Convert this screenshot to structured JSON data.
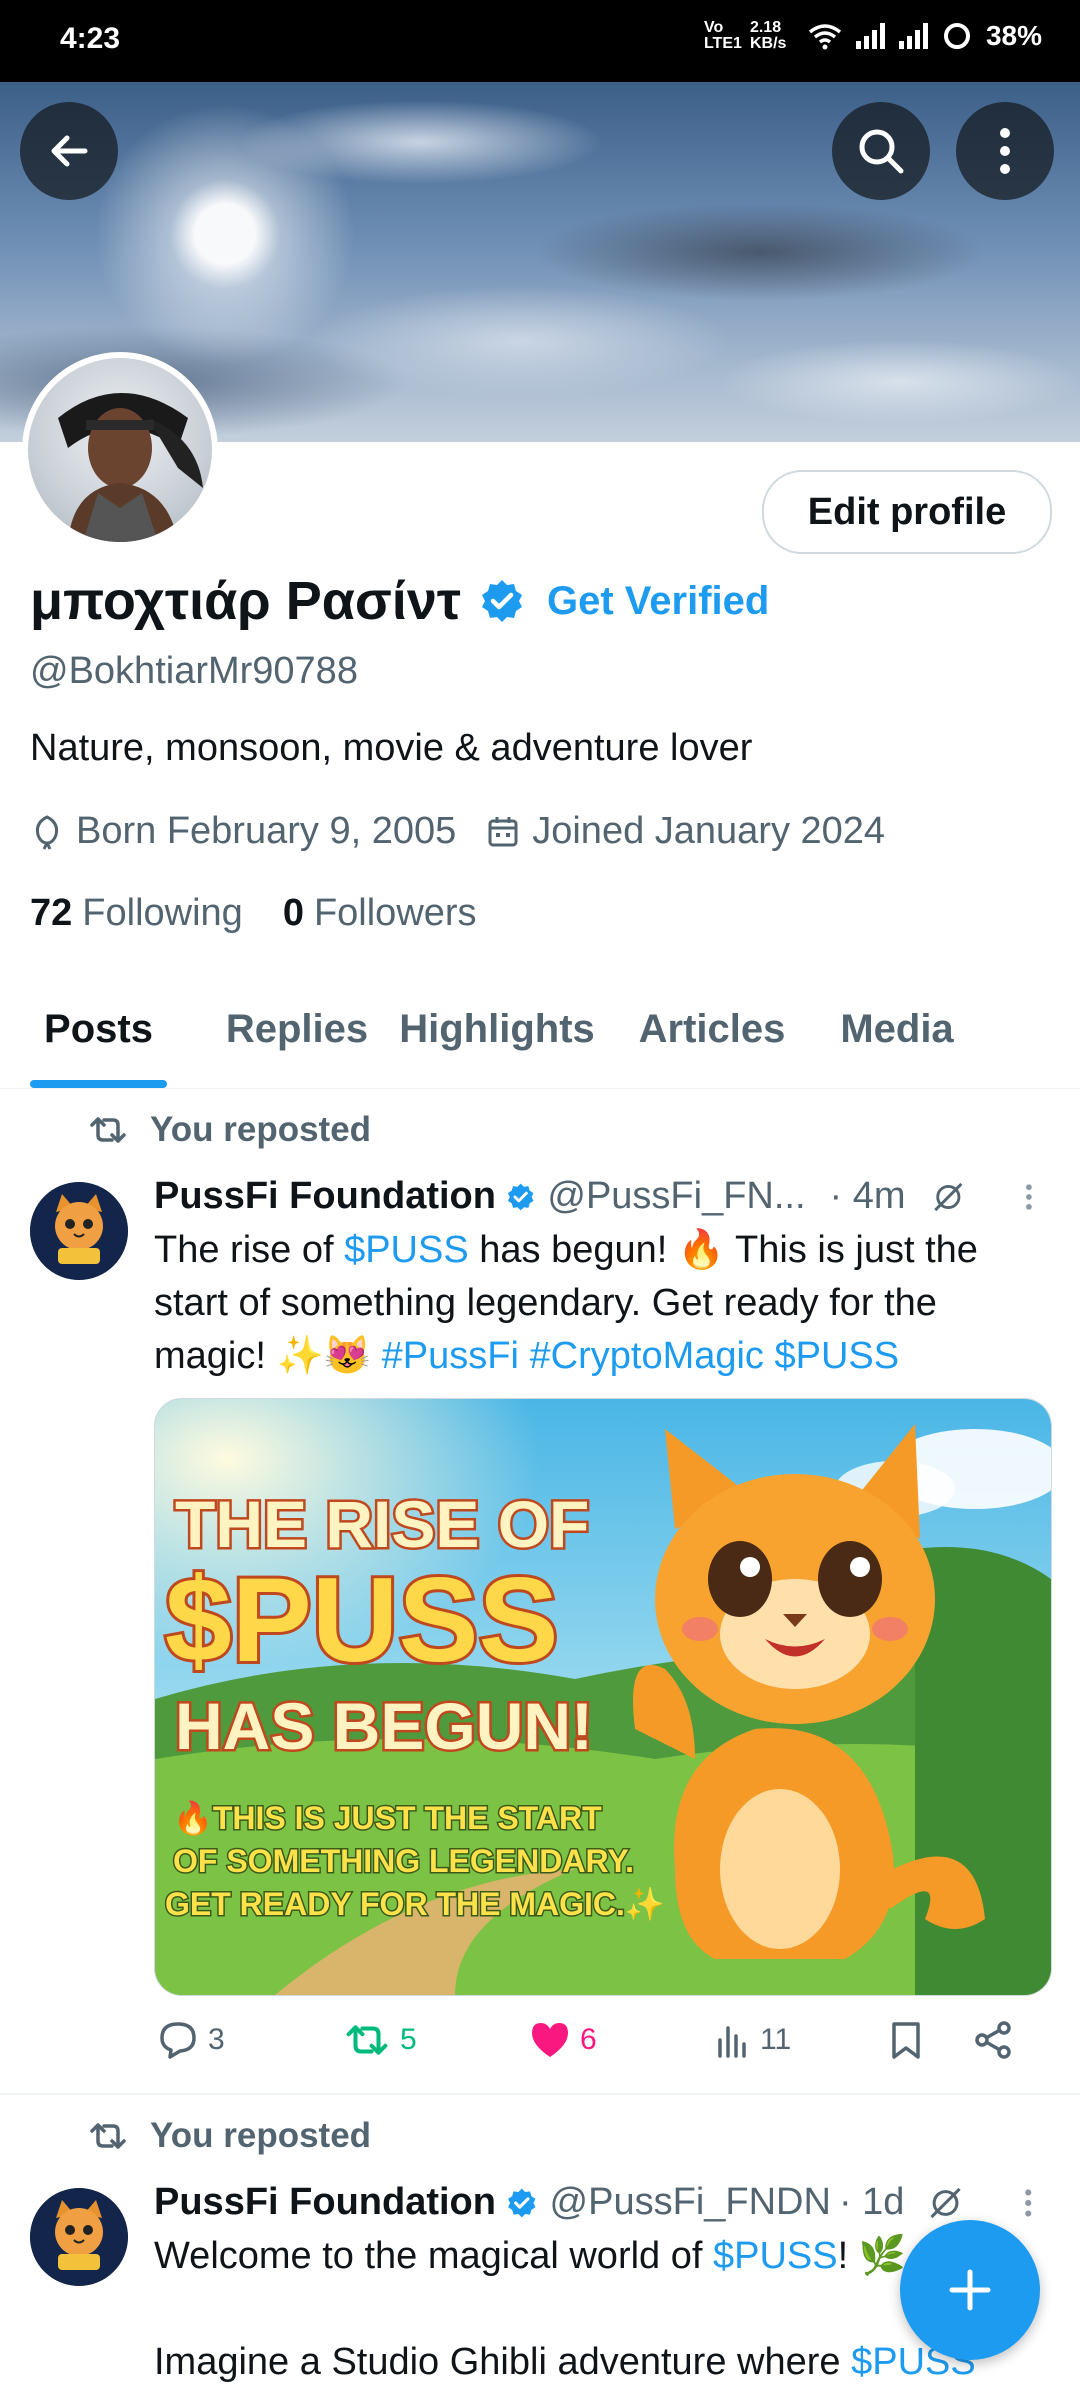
{
  "status_bar": {
    "time": "4:23",
    "network": "Vo LTE1",
    "speed": "2.18 KB/s",
    "battery": "38%"
  },
  "profile": {
    "display_name": "μποχτιάρ Ρασίντ",
    "get_verified_label": "Get Verified",
    "handle": "@BokhtiarMr90788",
    "bio": "Nature, monsoon, movie & adventure lover",
    "born": "Born February 9, 2005",
    "joined": "Joined January 2024",
    "following_count": "72",
    "following_label": "Following",
    "followers_count": "0",
    "followers_label": "Followers",
    "edit_profile_label": "Edit profile"
  },
  "tabs": [
    {
      "label": "Posts",
      "active": true
    },
    {
      "label": "Replies"
    },
    {
      "label": "Highlights"
    },
    {
      "label": "Articles"
    },
    {
      "label": "Media"
    }
  ],
  "posts": [
    {
      "repost_label": "You reposted",
      "author": "PussFi Foundation",
      "handle": "@PussFi_FN...",
      "time": "· 4m",
      "avatar_badge": "PUSS",
      "text_1": "The rise of ",
      "link_1": "$PUSS",
      "text_2": " has begun! 🔥 This is just the start of something legendary. Get ready for the magic! ✨😻 ",
      "hashtag_1": "#PussFi",
      "hashtag_2": "#CryptoMagic",
      "link_2": "$PUSS",
      "image": {
        "line1": "THE RISE OF",
        "line2": "$PUSS",
        "line3": "HAS BEGUN!",
        "sub1": "🔥THIS IS JUST THE START",
        "sub2": "OF SOMETHING LEGENDARY.",
        "sub3": "GET READY FOR THE MAGIC.✨"
      },
      "replies": "3",
      "reposts": "5",
      "likes": "6",
      "views": "11"
    },
    {
      "repost_label": "You reposted",
      "author": "PussFi Foundation",
      "handle": "@PussFi_FNDN",
      "time": "· 1d",
      "avatar_badge": "PUSS",
      "text_1": "Welcome to the magical world of ",
      "link_1": "$PUSS",
      "text_2": "! 🌿",
      "text_3": "Imagine a Studio Ghibli adventure where ",
      "link_2": "$PUSS"
    }
  ],
  "colors": {
    "accent": "#1d9bf0",
    "repost_green": "#00ba7c",
    "like_pink": "#f91880",
    "secondary_text": "#536471"
  }
}
